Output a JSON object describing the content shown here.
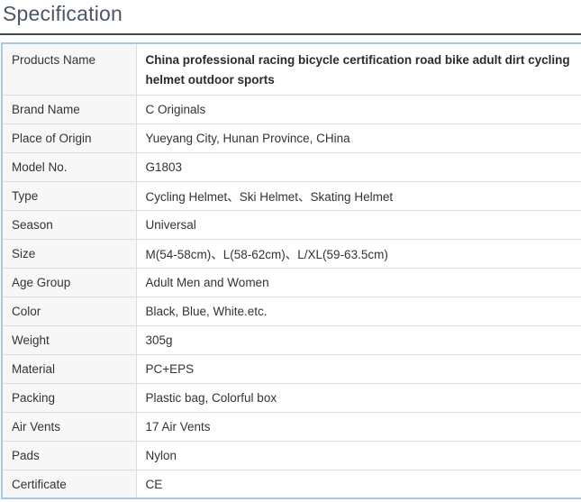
{
  "section": {
    "title": "Specification"
  },
  "spec": {
    "rows": [
      {
        "label": "Products Name",
        "value": "China professional racing bicycle certification road bike adult dirt cycling helmet outdoor sports"
      },
      {
        "label": "Brand Name",
        "value": "C Originals"
      },
      {
        "label": "Place of Origin",
        "value": "Yueyang City, Hunan Province, CHina"
      },
      {
        "label": "Model No.",
        "value": "G1803"
      },
      {
        "label": "Type",
        "value": "Cycling Helmet、Ski Helmet、Skating Helmet"
      },
      {
        "label": "Season",
        "value": "Universal"
      },
      {
        "label": "Size",
        "value": "M(54-58cm)、L(58-62cm)、L/XL(59-63.5cm)"
      },
      {
        "label": "Age Group",
        "value": "Adult Men and Women"
      },
      {
        "label": "Color",
        "value": "Black, Blue, White.etc."
      },
      {
        "label": "Weight",
        "value": "305g"
      },
      {
        "label": "Material",
        "value": "PC+EPS"
      },
      {
        "label": "Packing",
        "value": "Plastic bag, Colorful box"
      },
      {
        "label": "Air Vents",
        "value": "17 Air Vents"
      },
      {
        "label": "Pads",
        "value": "Nylon"
      },
      {
        "label": "Certificate",
        "value": "CE"
      }
    ]
  }
}
